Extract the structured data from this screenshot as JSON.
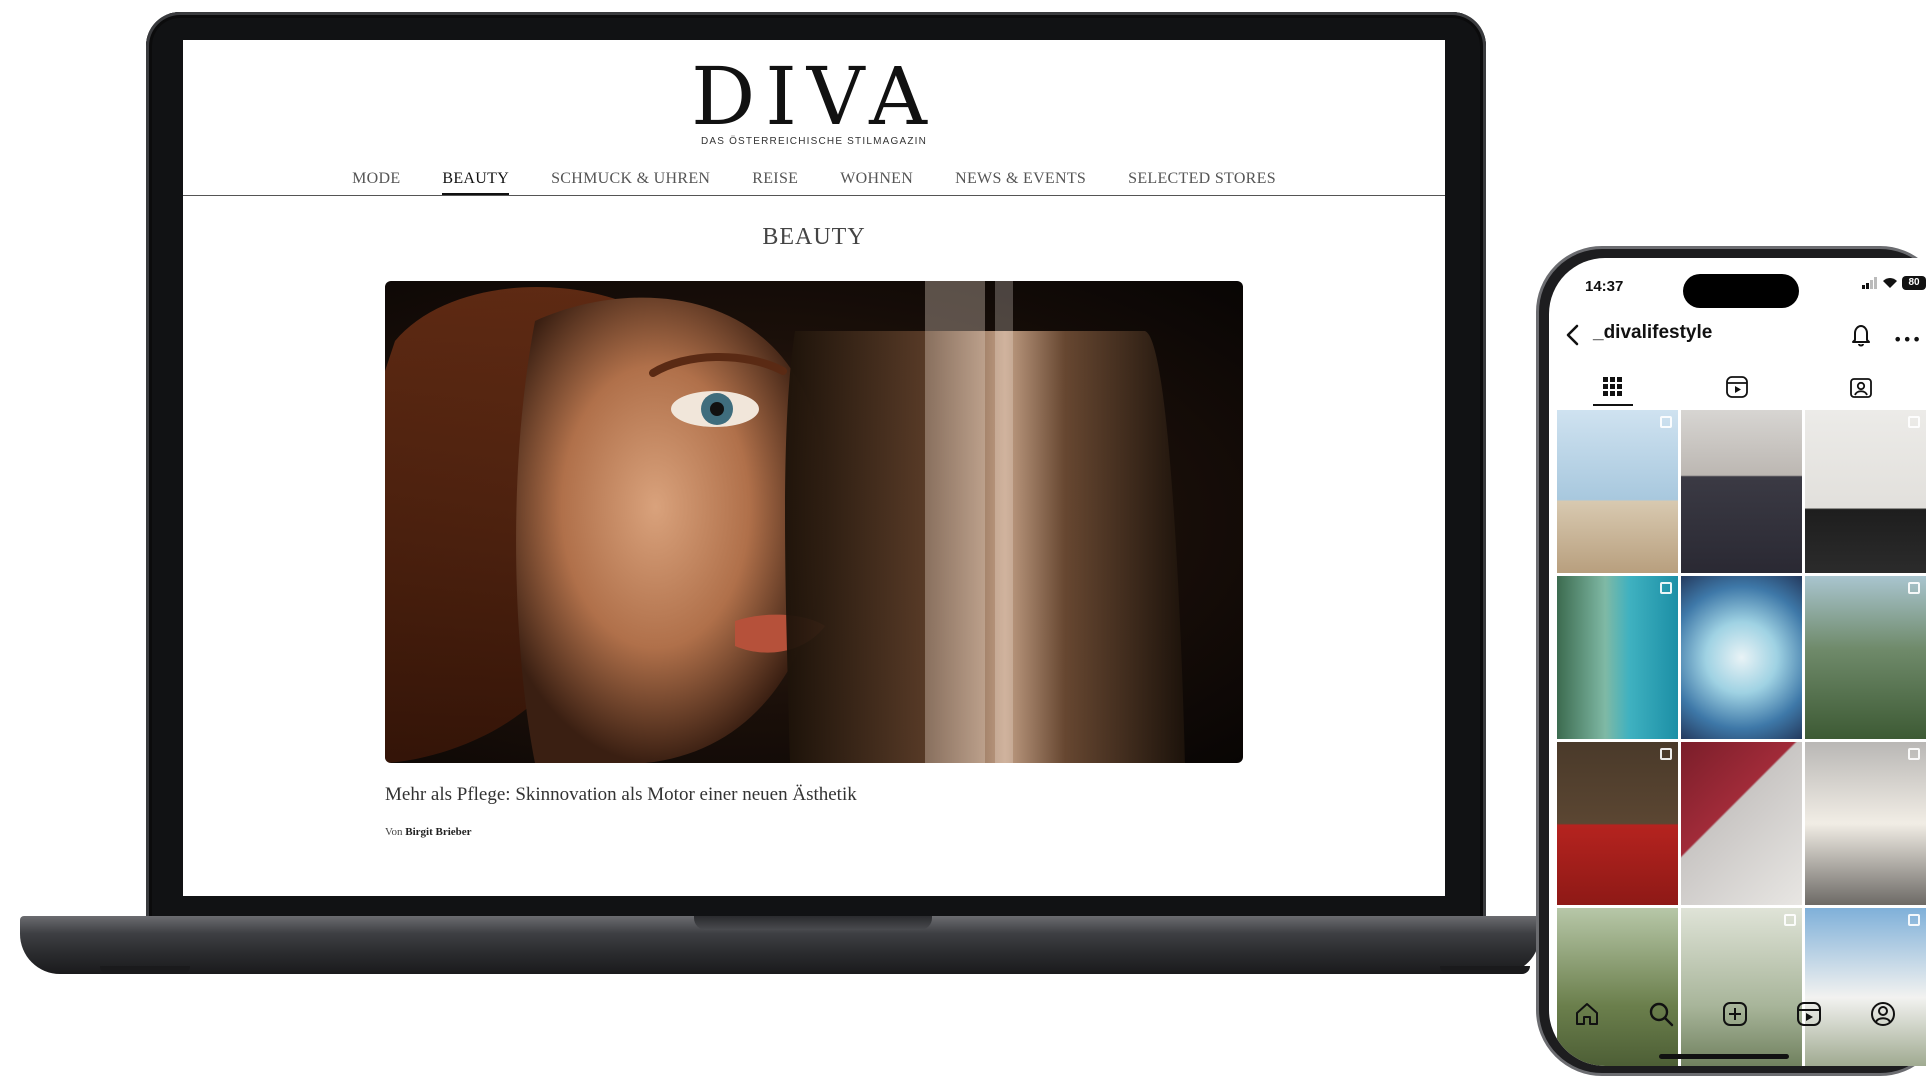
{
  "site": {
    "logo": "DIVA",
    "tagline": "DAS ÖSTERREICHISCHE STILMAGAZIN",
    "nav": [
      {
        "label": "MODE",
        "active": false
      },
      {
        "label": "BEAUTY",
        "active": true
      },
      {
        "label": "SCHMUCK & UHREN",
        "active": false
      },
      {
        "label": "REISE",
        "active": false
      },
      {
        "label": "WOHNEN",
        "active": false
      },
      {
        "label": "NEWS & EVENTS",
        "active": false
      },
      {
        "label": "SELECTED STORES",
        "active": false
      }
    ],
    "section_title": "BEAUTY",
    "article": {
      "title": "Mehr als Pflege: Skinnovation als Motor einer neuen Ästhetik",
      "byline_prefix": "Von",
      "author": "Birgit Brieber"
    }
  },
  "phone": {
    "status_time": "14:37",
    "battery": "80",
    "username": "_divalifestyle",
    "tabs": [
      "grid-icon",
      "reels-icon",
      "tagged-icon"
    ],
    "bottom_nav": [
      "home-icon",
      "search-icon",
      "create-icon",
      "reels-icon",
      "profile-icon"
    ],
    "tiles": [
      {
        "name": "tile-venice-window",
        "multi": true,
        "bg": "linear-gradient(#cfe2f0 0%, #a8c8de 55%, #d8c9b0 56%, #b89f7e 100%)"
      },
      {
        "name": "tile-man-shirt",
        "multi": false,
        "bg": "linear-gradient(#d7d5d2 0%, #bcb7b2 40%, #3b3a44 41%, #2a2933 100%)"
      },
      {
        "name": "tile-fashion-black",
        "multi": true,
        "bg": "linear-gradient(#ecebe8 0%, #e2e0dc 60%, #1e1e1e 61%, #2b2b2b 100%)"
      },
      {
        "name": "tile-aerial-beach",
        "multi": true,
        "bg": "linear-gradient(90deg, #3c6b4f 0%, #7fb9a5 40%, #3fb1c0 60%, #1c8fa6 100%)"
      },
      {
        "name": "tile-watch",
        "multi": false,
        "bg": "radial-gradient(circle at 50% 50%, #e9f3f6 0%, #9fd2e3 35%, #3e78a8 70%, #243a5e 100%)"
      },
      {
        "name": "tile-tropical-house",
        "multi": true,
        "bg": "linear-gradient(#a9c5cf 0%, #6f8a6a 45%, #3d5a34 100%)"
      },
      {
        "name": "tile-luggage",
        "multi": true,
        "bg": "linear-gradient(#4a3a2a 0%, #5b4632 50%, #b5231f 51%, #8e1916 100%)"
      },
      {
        "name": "tile-chanel-bag",
        "multi": false,
        "bg": "linear-gradient(135deg, #7a1e2a 0%, #a12b39 40%, #c9c6c4 41%, #e8e6e3 100%)"
      },
      {
        "name": "tile-street-dress",
        "multi": true,
        "bg": "linear-gradient(#b9b7b5 0%, #f1ede5 50%, #6d6a66 100%)"
      },
      {
        "name": "tile-palm-trees",
        "multi": false,
        "bg": "linear-gradient(#b7c7a8 0%, #6b7f4c 60%, #4b5c34 100%)"
      },
      {
        "name": "tile-misty-forest",
        "multi": true,
        "bg": "linear-gradient(#dfe3d7 0%, #a8b59a 60%, #6c7d5a 100%)"
      },
      {
        "name": "tile-white-villa",
        "multi": true,
        "bg": "linear-gradient(#7fb0d9 0%, #f2f2f0 55%, #9aa58a 100%)"
      }
    ]
  },
  "colors": {
    "ink": "#111111",
    "nav_text": "#555555",
    "laptop_frame": "#111214",
    "phone_frame": "#1d1d1f"
  }
}
